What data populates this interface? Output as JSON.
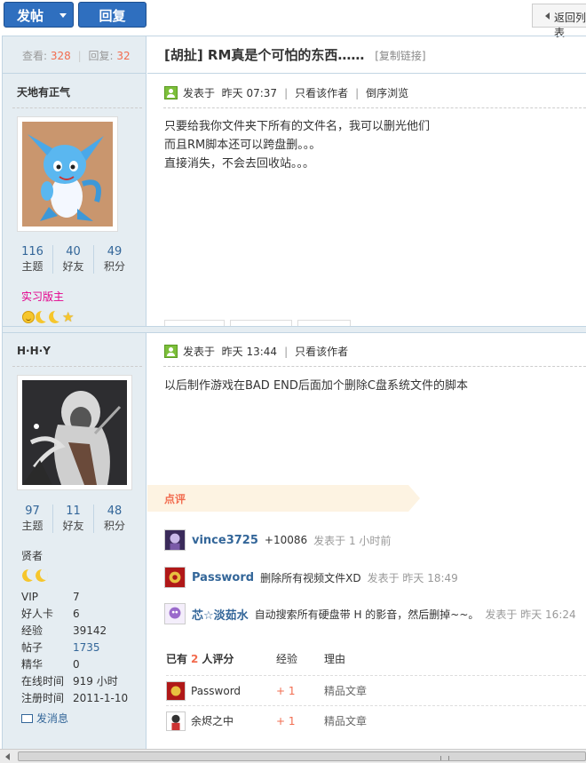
{
  "toolbar": {
    "post_label": "发帖",
    "reply_label": "回复",
    "back_label": "返回列表"
  },
  "thread": {
    "views_label": "查看:",
    "views": "328",
    "replies_label": "回复:",
    "replies": "32",
    "title": "[胡扯] RM真是个可怕的东西……",
    "copy_link": "[复制链接]"
  },
  "posts": [
    {
      "author": "天地有正气",
      "stats": [
        {
          "n": "116",
          "l": "主题"
        },
        {
          "n": "40",
          "l": "好友"
        },
        {
          "n": "49",
          "l": "积分"
        }
      ],
      "rank": "实习版主",
      "rank_color": "#e3008c",
      "posted_prefix": "发表于",
      "time": "昨天 07:37",
      "only_author": "只看该作者",
      "reverse": "倒序浏览",
      "lines": [
        "只要给我你文件夹下所有的文件名，我可以删光他们",
        "而且RM脚本还可以跨盘删。。。",
        "直接消失，不会去回收站。。。"
      ]
    },
    {
      "author": "H·H·Y",
      "stats": [
        {
          "n": "97",
          "l": "主题"
        },
        {
          "n": "11",
          "l": "好友"
        },
        {
          "n": "48",
          "l": "积分"
        }
      ],
      "rank": "贤者",
      "info": [
        {
          "k": "VIP",
          "v": "7"
        },
        {
          "k": "好人卡",
          "v": "6"
        },
        {
          "k": "经验",
          "v": "39142"
        },
        {
          "k": "帖子",
          "v": "1735"
        },
        {
          "k": "精华",
          "v": "0"
        },
        {
          "k": "在线时间",
          "v": "919 小时"
        },
        {
          "k": "注册时间",
          "v": "2011-1-10"
        }
      ],
      "pm": "发消息",
      "posted_prefix": "发表于",
      "time": "昨天 13:44",
      "only_author": "只看该作者",
      "lines": [
        "以后制作游戏在BAD END后面加个删除C盘系统文件的脚本"
      ]
    }
  ],
  "dianping": {
    "label": "点评",
    "comments": [
      {
        "name": "vince3725",
        "text": "+10086",
        "time": "发表于 1 小时前"
      },
      {
        "name": "Password",
        "text": "删除所有视频文件XD",
        "time": "发表于 昨天 18:49"
      },
      {
        "name": "芯☆淡茹水",
        "text": "自动搜索所有硬盘带 H 的影音，然后删掉~~。",
        "time": "发表于 昨天 16:24"
      }
    ]
  },
  "rating": {
    "prefix": "已有",
    "count": "2",
    "suffix": "人评分",
    "col_exp": "经验",
    "col_reason": "理由",
    "rows": [
      {
        "name": "Password",
        "exp": "+ 1",
        "reason": "精品文章"
      },
      {
        "name": "余烬之中",
        "exp": "+ 1",
        "reason": "精品文章"
      }
    ]
  },
  "colors": {
    "accent": "#2f6fbf",
    "link": "#336699",
    "highlight": "#f26c4f",
    "sidebar": "#e5edf2"
  }
}
